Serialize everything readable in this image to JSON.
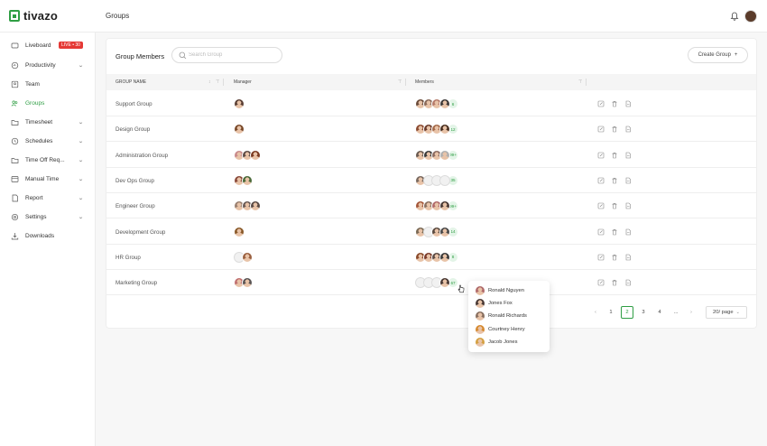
{
  "app": {
    "logo": "tivazo",
    "page_title": "Groups"
  },
  "sidebar": {
    "items": [
      {
        "label": "Liveboard",
        "icon": "liveboard-icon",
        "badge": "LIVE • 30",
        "chevron": false,
        "active": false
      },
      {
        "label": "Productivity",
        "icon": "productivity-icon",
        "chevron": true,
        "active": false
      },
      {
        "label": "Team",
        "icon": "team-icon",
        "chevron": false,
        "active": false
      },
      {
        "label": "Groups",
        "icon": "groups-icon",
        "chevron": false,
        "active": true
      },
      {
        "label": "Timesheet",
        "icon": "timesheet-icon",
        "chevron": true,
        "active": false
      },
      {
        "label": "Schedules",
        "icon": "schedules-icon",
        "chevron": true,
        "active": false
      },
      {
        "label": "Time Off Req...",
        "icon": "time-off-icon",
        "chevron": true,
        "active": false
      },
      {
        "label": "Manual Time",
        "icon": "manual-time-icon",
        "chevron": true,
        "active": false
      },
      {
        "label": "Report",
        "icon": "report-icon",
        "chevron": true,
        "active": false
      },
      {
        "label": "Settings",
        "icon": "settings-icon",
        "chevron": true,
        "active": false
      },
      {
        "label": "Downloads",
        "icon": "download-icon",
        "chevron": false,
        "active": false
      }
    ]
  },
  "panel": {
    "title": "Group Members",
    "search_placeholder": "Search Group",
    "create_label": "Create Group",
    "columns": {
      "name": "GROUP NAME",
      "manager": "Manager",
      "members": "Members"
    }
  },
  "rows": [
    {
      "name": "Support Group",
      "managers": [
        "#5b4035"
      ],
      "members": [
        "#6b4b3a",
        "#8a6a5a",
        "#b57a6a",
        "#3f3a38"
      ],
      "count": "6"
    },
    {
      "name": "Design Group",
      "managers": [
        "#7a4a2a"
      ],
      "members": [
        "#8b4a30",
        "#6a3a2a",
        "#a46a4a",
        "#4a3020"
      ],
      "count": "12"
    },
    {
      "name": "Administration Group",
      "managers": [
        "#c8898a",
        "#5c4a45",
        "#7a3a22"
      ],
      "members": [
        "#6a5a50",
        "#3a3a3a",
        "#8a6a60",
        "#b0b0b0"
      ],
      "count": "99+"
    },
    {
      "name": "Dev Ops Group",
      "managers": [
        "#8a4a3a",
        "#4a6a3a"
      ],
      "members": [
        "#7a6a60",
        "",
        "",
        ""
      ],
      "count": "35"
    },
    {
      "name": "Engineer Group",
      "managers": [
        "#9a8070",
        "#6a5a55",
        "#5a4a45"
      ],
      "members": [
        "#a4573a",
        "#8a7060",
        "#b06a6a",
        "#4a3a35"
      ],
      "count": "99+"
    },
    {
      "name": "Development Group",
      "managers": [
        "#8a5a2a"
      ],
      "members": [
        "#7a6a55",
        "",
        "#5a4a40",
        "#4a4a4a"
      ],
      "count": "14"
    },
    {
      "name": "HR Group",
      "managers": [
        "",
        "#9a6040"
      ],
      "members": [
        "#8a4a2a",
        "#7a3a2a",
        "#5a4a45",
        "#3a3a3a"
      ],
      "count": "8"
    },
    {
      "name": "Marketing Group",
      "managers": [
        "#c07070",
        "#5a5555"
      ],
      "members": [
        "",
        "",
        "",
        "#4a3a35"
      ],
      "count": "67"
    }
  ],
  "pagination": {
    "pages": [
      "1",
      "2",
      "3",
      "4",
      "..."
    ],
    "current": "2",
    "per_page": "20/ page"
  },
  "popover": {
    "members": [
      {
        "name": "Ronald Nguyen",
        "color": "#b06a6a"
      },
      {
        "name": "Jones Fox",
        "color": "#4a3a35"
      },
      {
        "name": "Ronald Richards",
        "color": "#8a7060"
      },
      {
        "name": "Courtney Henry",
        "color": "#d68a30"
      },
      {
        "name": "Jacob Jones",
        "color": "#d4a040"
      }
    ]
  },
  "colors": {
    "accent": "#2f9e44",
    "live": "#e53935"
  }
}
